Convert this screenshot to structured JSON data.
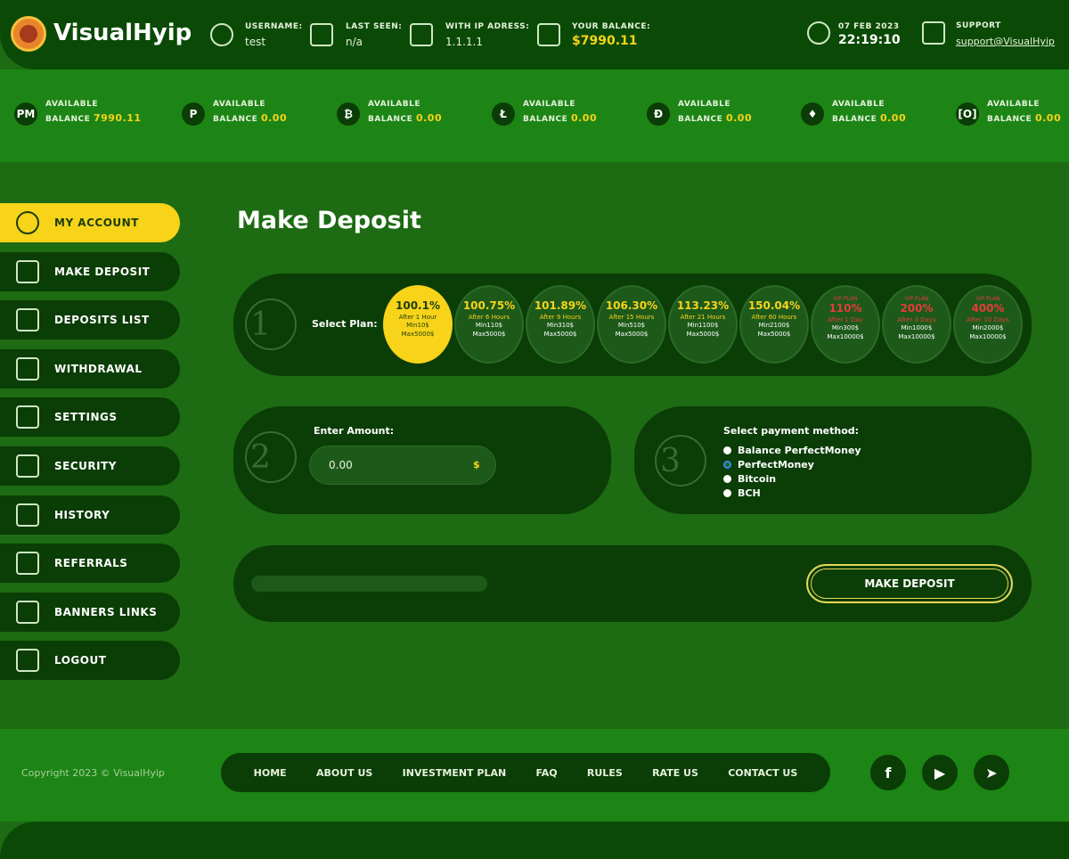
{
  "brand": {
    "name": "VisualHyip"
  },
  "header": {
    "username_label": "USERNAME:",
    "username": "test",
    "last_seen_label": "LAST SEEN:",
    "last_seen": "n/a",
    "ip_label": "WITH IP ADRESS:",
    "ip": "1.1.1.1",
    "balance_label": "YOUR BALANCE:",
    "balance": "$7990.11",
    "date": "07 FEB 2023",
    "time": "22:19:10",
    "support_label": "SUPPORT",
    "support_email": "support@VisualHyip"
  },
  "balances": [
    {
      "coin": "PM",
      "label": "AVAILABLE",
      "label2": "BALANCE",
      "value": "7990.11"
    },
    {
      "coin": "P",
      "label": "AVAILABLE",
      "label2": "BALANCE",
      "value": "0.00"
    },
    {
      "coin": "₿",
      "label": "AVAILABLE",
      "label2": "BALANCE",
      "value": "0.00"
    },
    {
      "coin": "Ł",
      "label": "AVAILABLE",
      "label2": "BALANCE",
      "value": "0.00"
    },
    {
      "coin": "Ð",
      "label": "AVAILABLE",
      "label2": "BALANCE",
      "value": "0.00"
    },
    {
      "coin": "♦",
      "label": "AVAILABLE",
      "label2": "BALANCE",
      "value": "0.00"
    },
    {
      "coin": "[O]",
      "label": "AVAILABLE",
      "label2": "BALANCE",
      "value": "0.00"
    }
  ],
  "sidebar": {
    "items": [
      {
        "label": "MY ACCOUNT",
        "icon": "user-circle-icon"
      },
      {
        "label": "MAKE DEPOSIT",
        "icon": "bar-chart-icon"
      },
      {
        "label": "DEPOSITS LIST",
        "icon": "money-list-icon"
      },
      {
        "label": "WITHDRAWAL",
        "icon": "wallet-icon"
      },
      {
        "label": "SETTINGS",
        "icon": "gear-user-icon"
      },
      {
        "label": "SECURITY",
        "icon": "shield-user-icon"
      },
      {
        "label": "HISTORY",
        "icon": "calendar-icon"
      },
      {
        "label": "REFERRALS",
        "icon": "people-icon"
      },
      {
        "label": "BANNERS LINKS",
        "icon": "link-icon"
      },
      {
        "label": "LOGOUT",
        "icon": "door-icon"
      }
    ]
  },
  "main": {
    "title": "Make Deposit",
    "step1": {
      "num": "1",
      "label": "Select Plan:"
    },
    "plans": [
      {
        "pct": "100.1%",
        "hrs": "After 1 Hour",
        "min": "Min10$",
        "max": "Max5000$"
      },
      {
        "pct": "100.75%",
        "hrs": "After 6 Hours",
        "min": "Min110$",
        "max": "Max5000$"
      },
      {
        "pct": "101.89%",
        "hrs": "After 9 Hours",
        "min": "Min310$",
        "max": "Max5000$"
      },
      {
        "pct": "106.30%",
        "hrs": "After 15 Hours",
        "min": "Min510$",
        "max": "Max5000$"
      },
      {
        "pct": "113.23%",
        "hrs": "After 21 Hours",
        "min": "Min1100$",
        "max": "Max5000$"
      },
      {
        "pct": "150.04%",
        "hrs": "After 60 Hours",
        "min": "Min2100$",
        "max": "Max5000$"
      },
      {
        "tag": "VIP PLAN",
        "pct": "110%",
        "hrs": "After 1 Day",
        "min": "Min300$",
        "max": "Max10000$"
      },
      {
        "tag": "VIP PLAN",
        "pct": "200%",
        "hrs": "After 3 Days",
        "min": "Min1000$",
        "max": "Max10000$"
      },
      {
        "tag": "VIP PLAN",
        "pct": "400%",
        "hrs": "After 10 Days",
        "min": "Min2000$",
        "max": "Max10000$"
      }
    ],
    "step2": {
      "num": "2",
      "label": "Enter Amount:",
      "value": "0.00",
      "currency": "$"
    },
    "step3": {
      "num": "3",
      "label": "Select payment method:",
      "methods": [
        "Balance PerfectMoney",
        "PerfectMoney",
        "Bitcoin",
        "BCH"
      ]
    },
    "deposit_button": "MAKE DEPOSIT"
  },
  "footer": {
    "copyright": "Copyright 2023 © VisualHyip",
    "nav": [
      "HOME",
      "ABOUT US",
      "INVESTMENT PLAN",
      "FAQ",
      "RULES",
      "RATE US",
      "CONTACT US"
    ],
    "social": [
      "f",
      "▶",
      "➤"
    ]
  }
}
